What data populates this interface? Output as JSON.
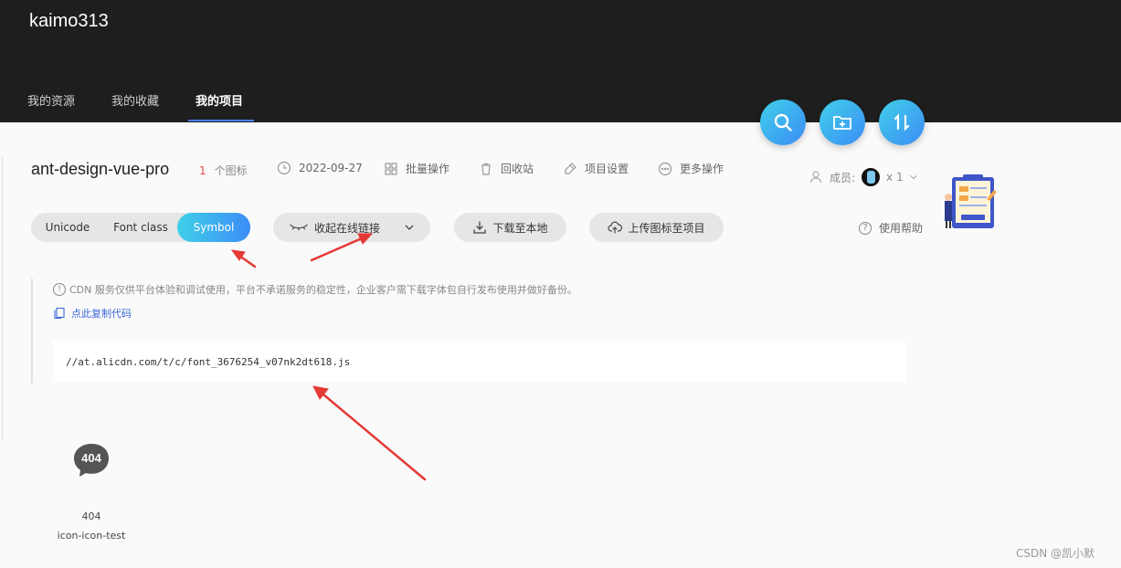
{
  "header": {
    "username": "kaimo313",
    "tabs": [
      {
        "label": "我的资源"
      },
      {
        "label": "我的收藏"
      },
      {
        "label": "我的项目",
        "active": true
      }
    ]
  },
  "fabs": [
    {
      "icon": "search-icon"
    },
    {
      "icon": "folder-add-icon"
    },
    {
      "icon": "sort-icon"
    }
  ],
  "project": {
    "name": "ant-design-vue-pro",
    "icon_count": "1",
    "icon_count_unit": "个图标",
    "date": "2022-09-27",
    "actions": {
      "batch": "批量操作",
      "recycle": "回收站",
      "settings": "项目设置",
      "more": "更多操作"
    },
    "members_label": "成员:",
    "members_count": "x 1",
    "help": "使用帮助"
  },
  "toolbar": {
    "formats": [
      "Unicode",
      "Font class",
      "Symbol"
    ],
    "selected_format": "Symbol",
    "collapse_link": "收起在线链接",
    "download": "下载至本地",
    "upload": "上传图标至项目"
  },
  "cdn": {
    "notice": "CDN 服务仅供平台体验和调试使用，平台不承诺服务的稳定性，企业客户需下载字体包自行发布使用并做好备份。",
    "copy_code": "点此复制代码",
    "url": "//at.alicdn.com/t/c/font_3676254_v07nk2dt618.js"
  },
  "icons": [
    {
      "glyph_text": "404",
      "name": "404",
      "code": "icon-icon-test"
    }
  ],
  "watermark": "CSDN @凯小默",
  "colors": {
    "header_bg": "#1e1e1e",
    "accent_gradient_start": "#3fd0e8",
    "accent_gradient_end": "#3c8cf6",
    "annotation_arrow": "#e53935",
    "count_red": "#e5484d",
    "link_blue": "#3e68d8"
  }
}
